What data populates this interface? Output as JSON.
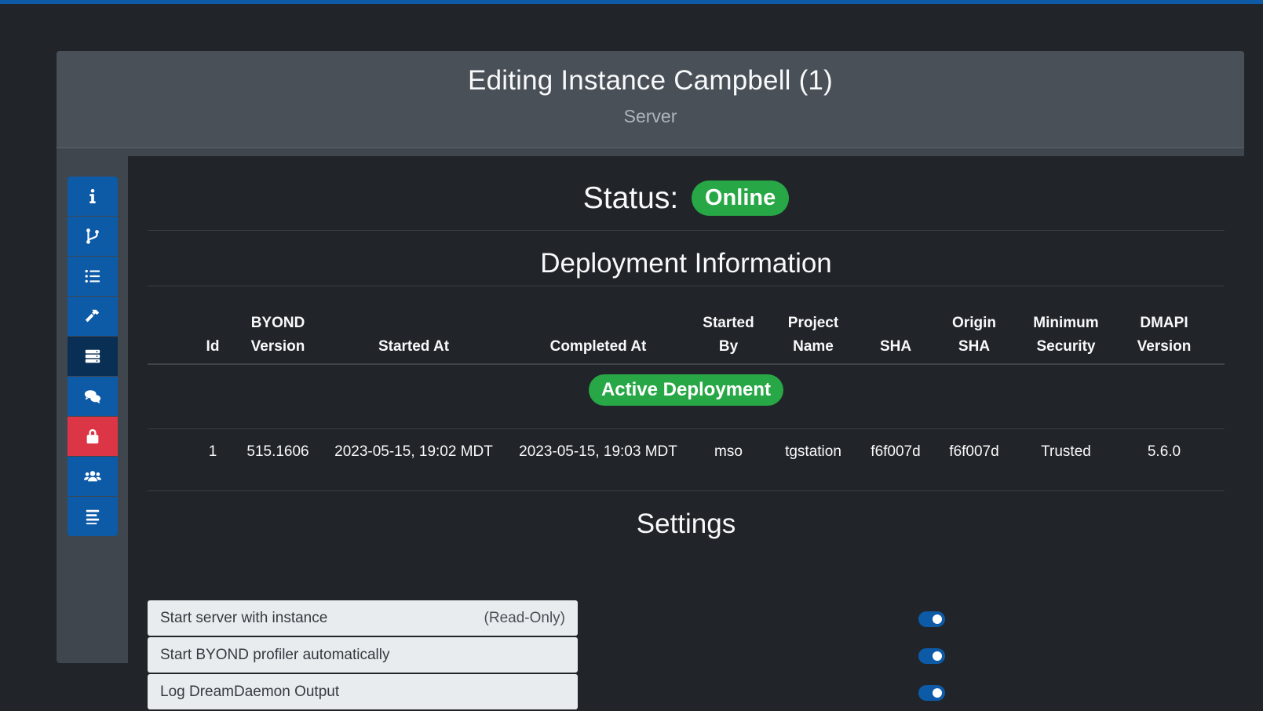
{
  "header": {
    "title": "Editing Instance Campbell (1)",
    "subtitle": "Server"
  },
  "sidebar": {
    "items": [
      {
        "icon": "info-icon",
        "state": "default"
      },
      {
        "icon": "code-branch-icon",
        "state": "default"
      },
      {
        "icon": "list-icon",
        "state": "default"
      },
      {
        "icon": "hammer-icon",
        "state": "default"
      },
      {
        "icon": "server-icon",
        "state": "active"
      },
      {
        "icon": "comments-icon",
        "state": "default"
      },
      {
        "icon": "lock-icon",
        "state": "danger"
      },
      {
        "icon": "users-icon",
        "state": "default"
      },
      {
        "icon": "menu-lines-icon",
        "state": "default"
      }
    ]
  },
  "status": {
    "label": "Status:",
    "value": "Online"
  },
  "deployment": {
    "title": "Deployment Information",
    "columns": [
      [
        "Id"
      ],
      [
        "BYOND",
        "Version"
      ],
      [
        "Started At"
      ],
      [
        "Completed At"
      ],
      [
        "Started",
        "By"
      ],
      [
        "Project",
        "Name"
      ],
      [
        "SHA"
      ],
      [
        "Origin",
        "SHA"
      ],
      [
        "Minimum",
        "Security"
      ],
      [
        "DMAPI",
        "Version"
      ]
    ],
    "active_label": "Active Deployment",
    "row": [
      "1",
      "515.1606",
      "2023-05-15, 19:02 MDT",
      "2023-05-15, 19:03 MDT",
      "mso",
      "tgstation",
      "f6f007d",
      "f6f007d",
      "Trusted",
      "5.6.0"
    ]
  },
  "settings": {
    "title": "Settings",
    "items": [
      {
        "label": "Start server with instance",
        "note": "(Read-Only)",
        "enabled": true
      },
      {
        "label": "Start BYOND profiler automatically",
        "note": "",
        "enabled": true
      },
      {
        "label": "Log DreamDaemon Output",
        "note": "",
        "enabled": true
      }
    ]
  },
  "colors": {
    "accent": "#0d5aa7",
    "success": "#27a745",
    "danger": "#dc3545",
    "background": "#212428"
  }
}
